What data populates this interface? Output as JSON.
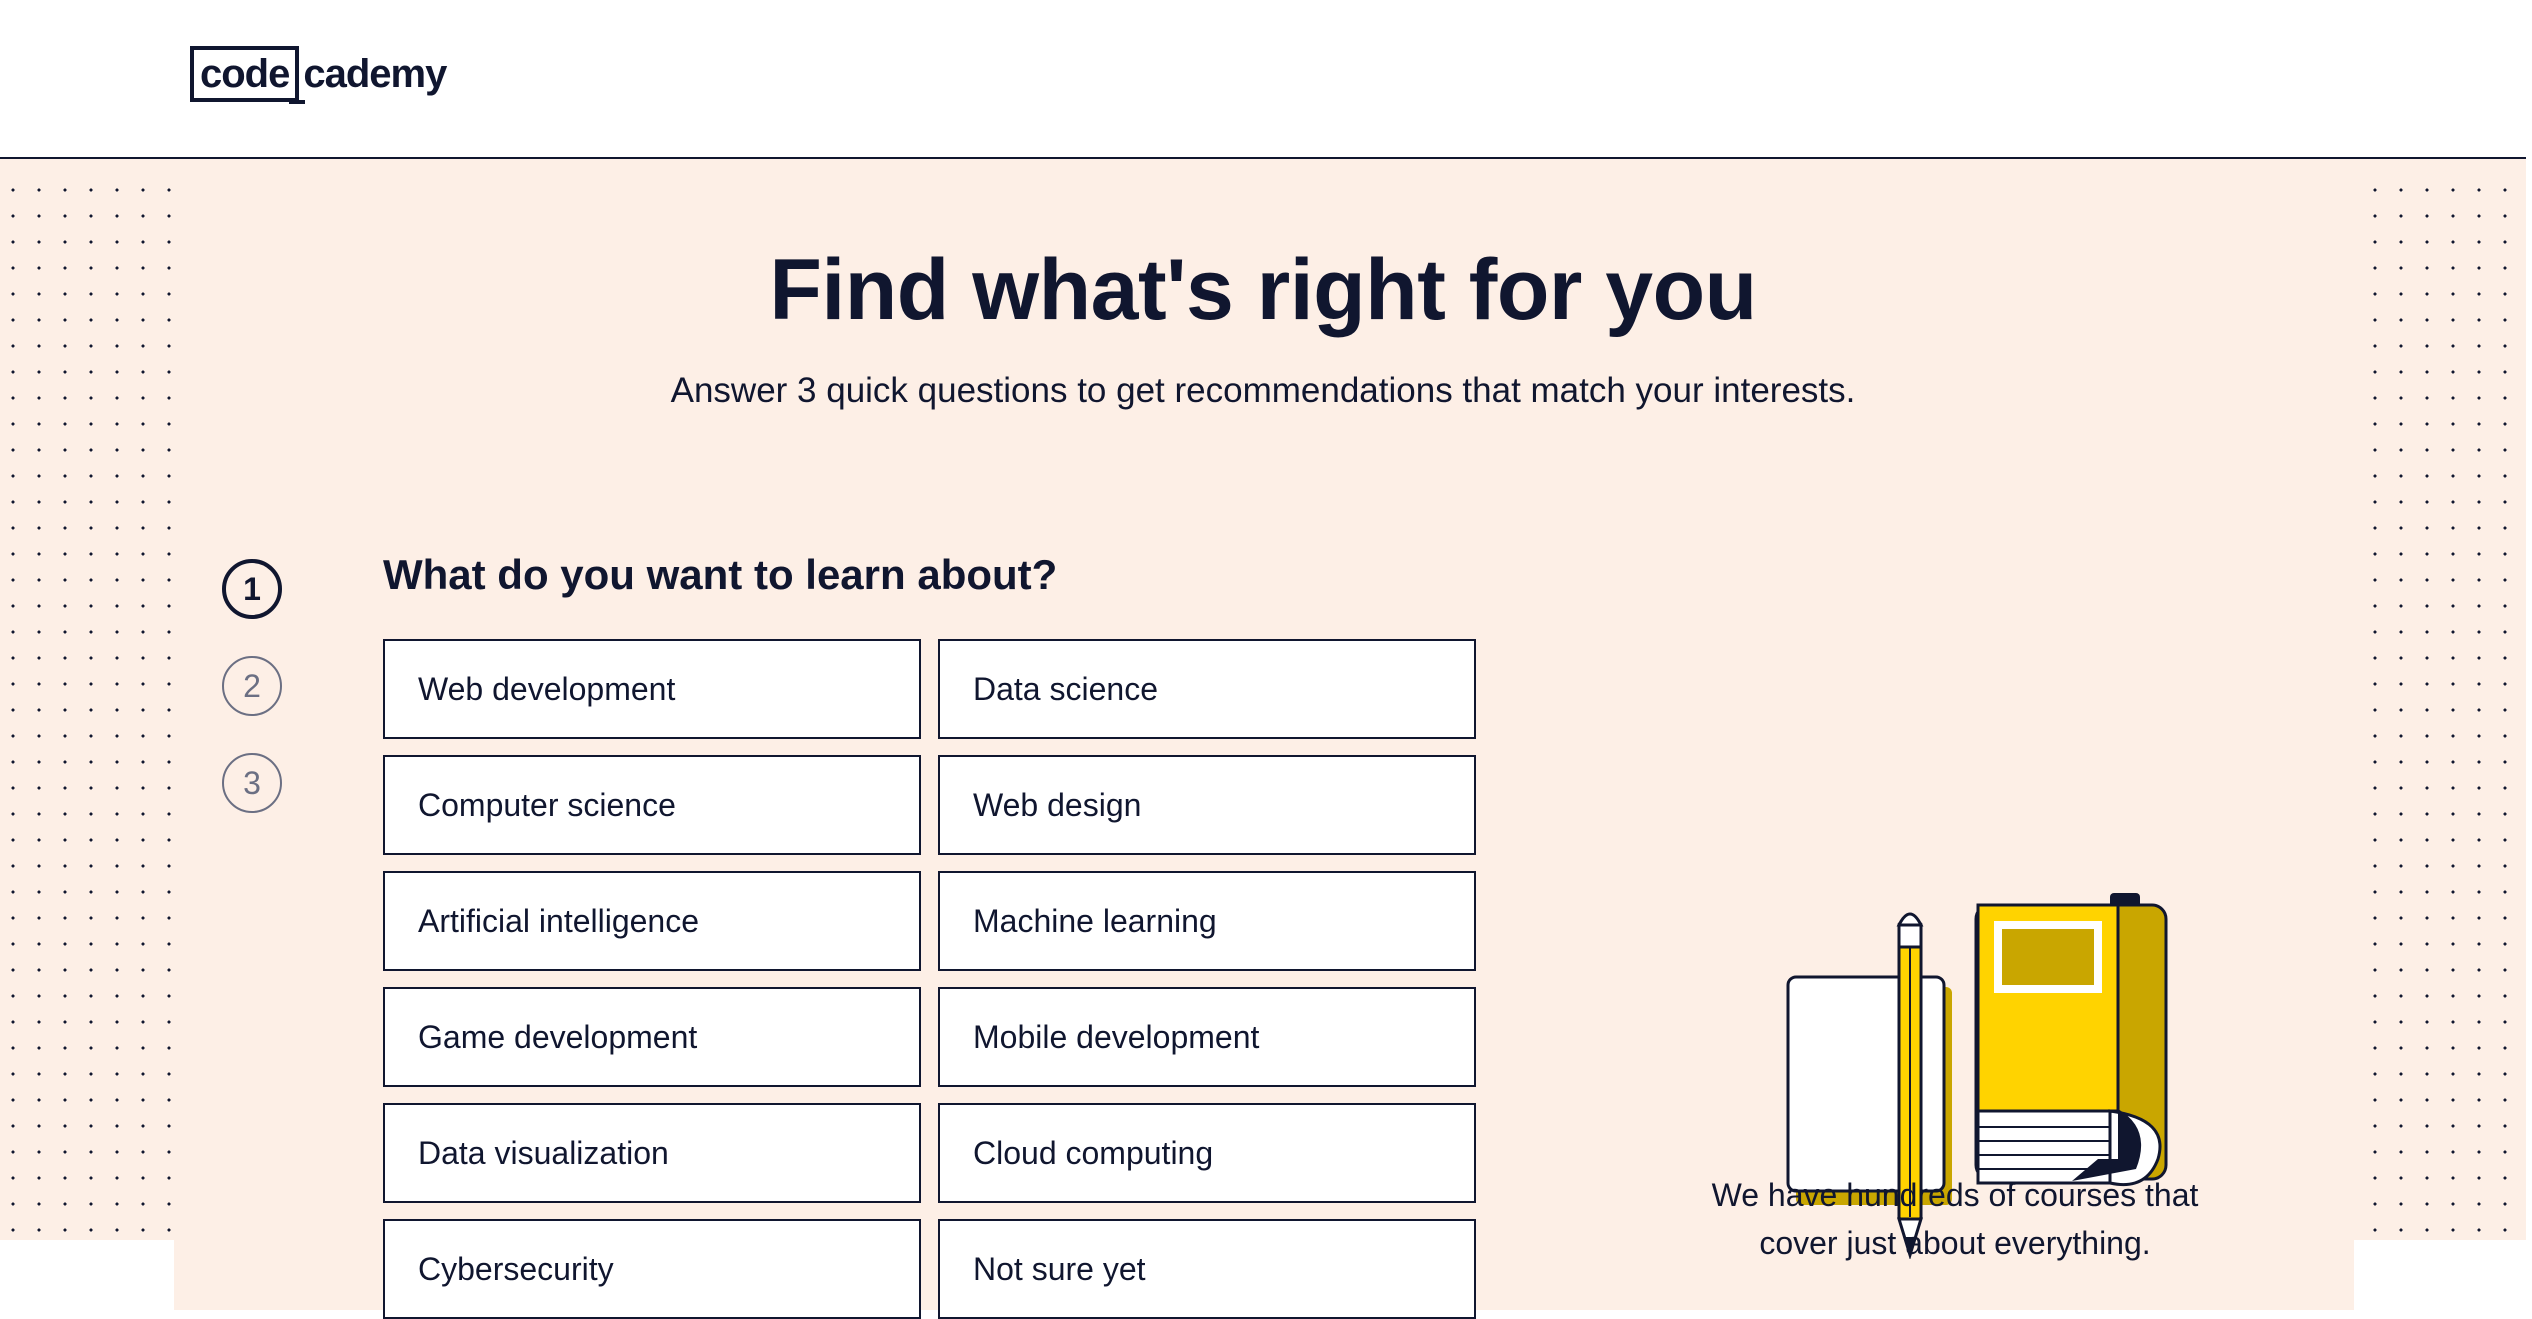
{
  "header": {
    "logo_left": "code",
    "logo_right": "cademy"
  },
  "hero": {
    "title": "Find what's right for you",
    "subtitle": "Answer 3 quick questions to get recommendations that match your interests."
  },
  "steps": [
    {
      "number": "1",
      "state": "active"
    },
    {
      "number": "2",
      "state": "inactive"
    },
    {
      "number": "3",
      "state": "inactive"
    }
  ],
  "question": {
    "title": "What do you want to learn about?",
    "options": [
      "Web development",
      "Data science",
      "Computer science",
      "Web design",
      "Artificial intelligence",
      "Machine learning",
      "Game development",
      "Mobile development",
      "Data visualization",
      "Cloud computing",
      "Cybersecurity",
      "Not sure yet"
    ]
  },
  "side": {
    "caption_line1": "We have hundreds of courses that",
    "caption_line2": "cover just about everything."
  },
  "colors": {
    "navy": "#10162f",
    "peach": "#fdefe6",
    "yellow": "#ffd300",
    "mustard": "#c9a600"
  },
  "icons": {
    "illustration": "notebook-pencil-book-illustration"
  }
}
